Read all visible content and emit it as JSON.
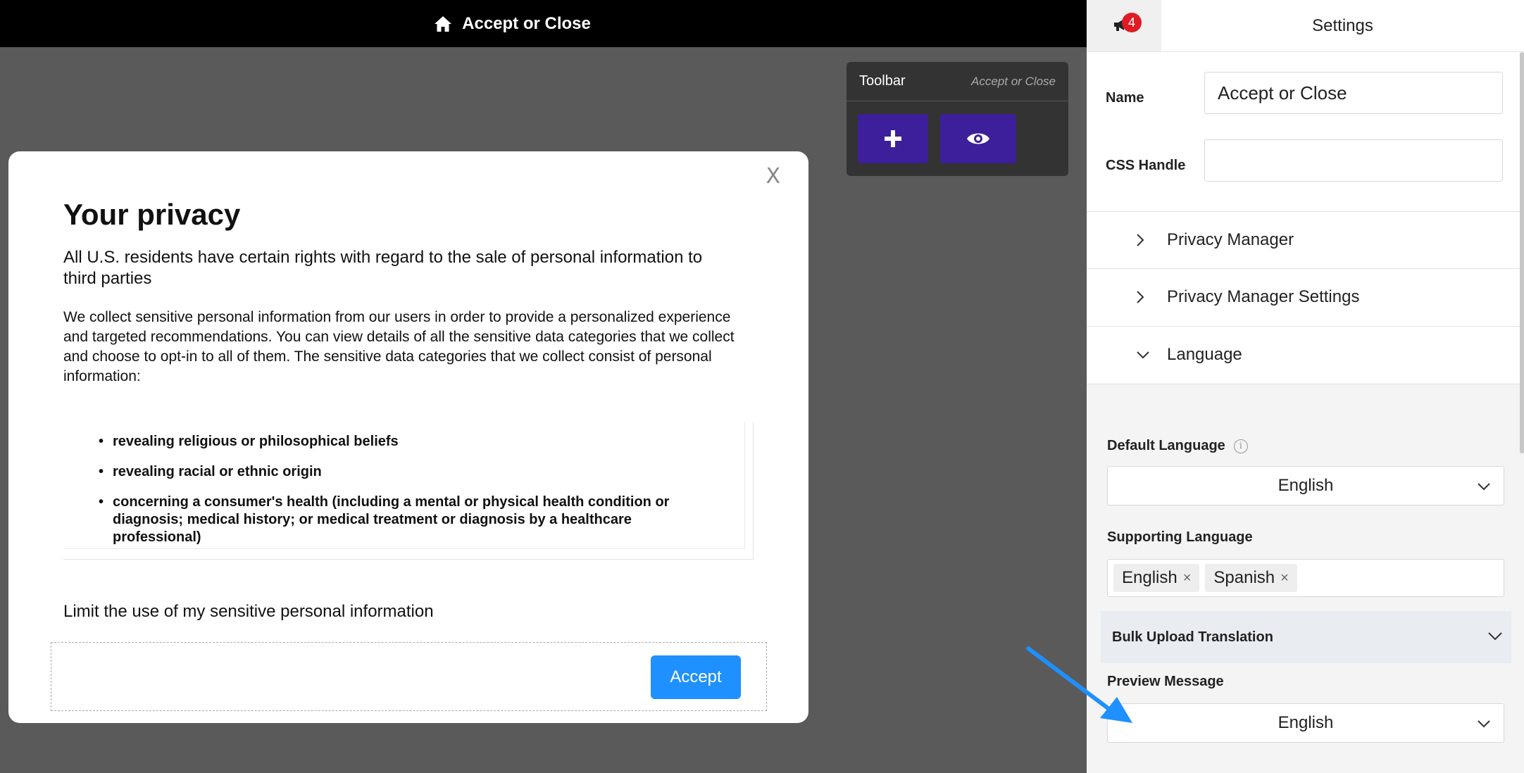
{
  "topbar": {
    "title": "Accept or Close",
    "icon": "home-icon"
  },
  "toolbar": {
    "title": "Toolbar",
    "subtitle": "Accept or Close",
    "add_icon": "plus-icon",
    "preview_icon": "eye-icon"
  },
  "modal": {
    "close_label": "X",
    "title": "Your privacy",
    "lead": "All U.S. residents have certain rights with regard to the sale of personal information to third parties",
    "body": "We collect sensitive personal information from our users in order to provide a personalized experience and targeted recommendations. You can view details of all the sensitive data categories that we collect and choose to opt-in to all of them. The sensitive data categories that we collect consist of personal information:",
    "categories": [
      "revealing religious or philosophical beliefs",
      "revealing racial or ethnic origin",
      "concerning a consumer's health (including a mental or physical health condition or diagnosis; medical history; or medical treatment or diagnosis by a healthcare professional)"
    ],
    "limit_text": "Limit the use of my sensitive personal information",
    "accept_label": "Accept"
  },
  "panel": {
    "notification_count": "4",
    "title": "Settings",
    "name_label": "Name",
    "name_value": "Accept or Close",
    "css_label": "CSS Handle",
    "css_value": "",
    "accordions": [
      "Privacy Manager",
      "Privacy Manager Settings",
      "Language"
    ],
    "default_language_label": "Default Language",
    "default_language_value": "English",
    "supporting_language_label": "Supporting Language",
    "supporting_languages": [
      "English",
      "Spanish"
    ],
    "bulk_upload_label": "Bulk Upload Translation",
    "preview_message_label": "Preview Message",
    "preview_message_value": "English"
  },
  "colors": {
    "accent": "#1e90ff",
    "toolbar_button": "#3d1f9b",
    "badge": "#e01b24"
  }
}
